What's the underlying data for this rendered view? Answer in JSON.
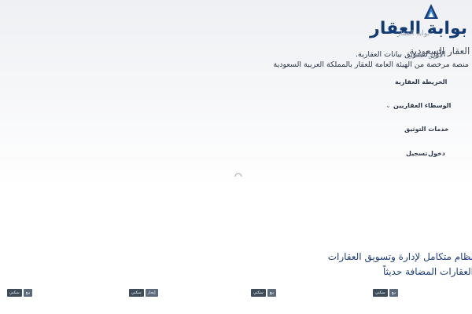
{
  "header": {
    "logo_icon": "triangle-logo-icon",
    "brand_title": "بوابة العقار",
    "ghost_nav_label": "بوابة العقار"
  },
  "hero": {
    "title_line": "منصة العقار السعودية",
    "subtitle_line1": "الأول لتسويق بيانات العقارية.",
    "ghost_nav_label2": "سوق العقار",
    "subtitle_line2": "منصة مرخصة من الهيئة العامة للعقار بالمملكة العربية السعودية"
  },
  "nav": {
    "items": [
      {
        "label": "الخريطة العقارية"
      },
      {
        "label": "الوسطاء العقاريين",
        "has_dropdown": true
      },
      {
        "label": "خدمات التوثيق"
      }
    ],
    "login_label": "دخول",
    "register_label": "تسجيل"
  },
  "main": {
    "section_heading_1": "نظام متكامل لإدارة وتسويق العقارات",
    "section_heading_2": "العقارات المضافة حديثاً"
  },
  "cards": [
    {
      "tag_type": "بيع",
      "tag_category": "سكني"
    },
    {
      "tag_type": "إيجار",
      "tag_category": "سكني"
    },
    {
      "tag_type": "بيع",
      "tag_category": "سكني"
    },
    {
      "tag_type": "بيع",
      "tag_category": "سكني"
    }
  ]
}
